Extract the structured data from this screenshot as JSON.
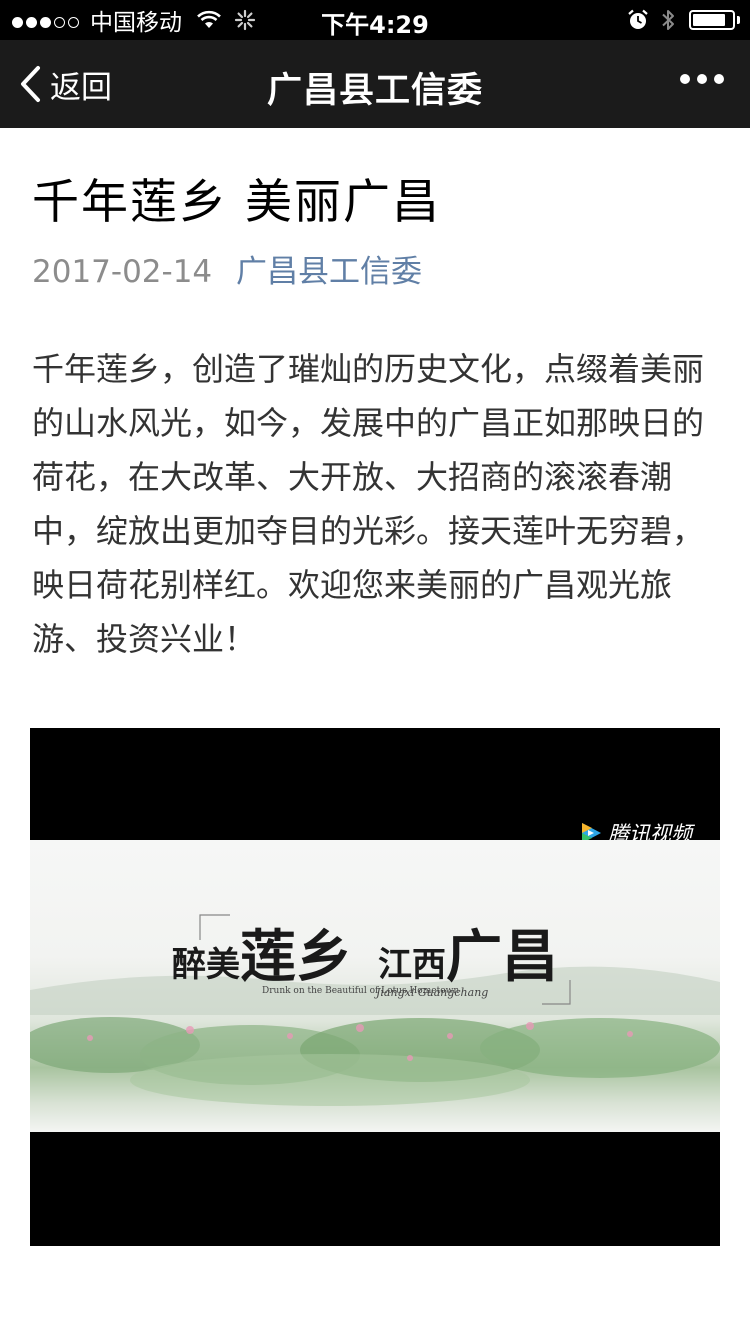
{
  "status_bar": {
    "signal": {
      "full": 3,
      "total": 5
    },
    "carrier": "中国移动",
    "time": "下午4:29",
    "battery_level": 0.85
  },
  "nav": {
    "back_label": "返回",
    "title": "广昌县工信委"
  },
  "article": {
    "title": "千年莲乡 美丽广昌",
    "date": "2017-02-14",
    "author": "广昌县工信委",
    "body": "千年莲乡，创造了璀灿的历史文化，点缀着美丽的山水风光，如今，发展中的广昌正如那映日的荷花，在大改革、大开放、大招商的滚滚春潮中，绽放出更加夺目的光彩。接天莲叶无穷碧，映日荷花别样红。欢迎您来美丽的广昌观光旅游、投资兴业！"
  },
  "video": {
    "brand": "腾讯视频",
    "calligraphy_1": "醉美",
    "calligraphy_2": "莲乡",
    "calligraphy_3": "江西",
    "calligraphy_4": "广昌",
    "subtitle_en": "Drunk on the Beautiful of Lotus Hometown",
    "subtitle_pinyin": "Jiangxi Guangchang"
  },
  "colors": {
    "nav_bg": "#1b1b1b",
    "author_link": "#607fa6",
    "date_gray": "#8c8c8c",
    "body_text": "#333333"
  }
}
